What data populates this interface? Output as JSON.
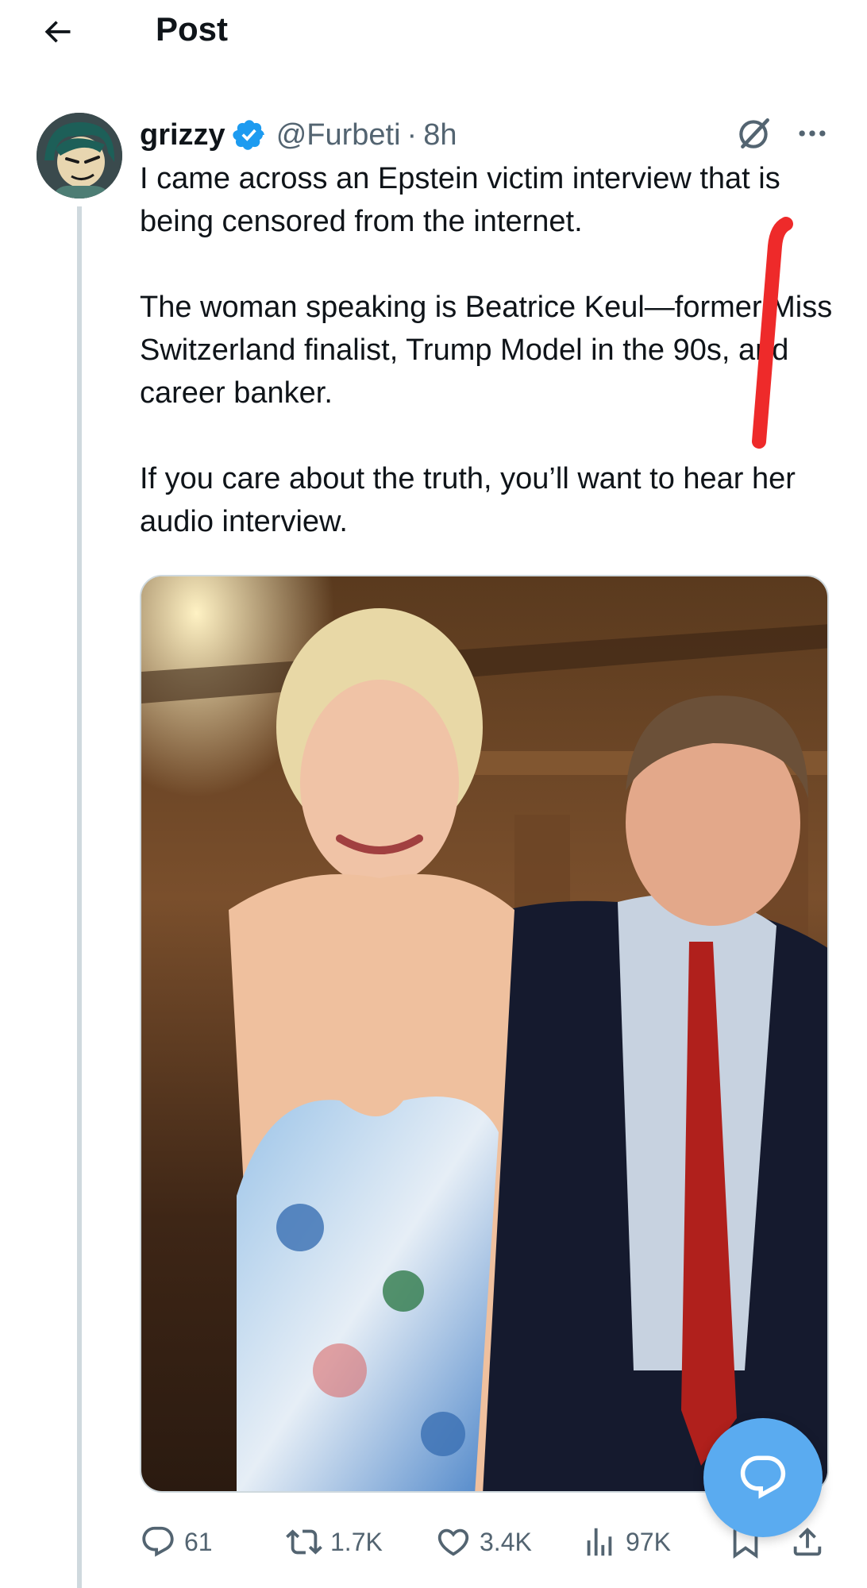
{
  "header": {
    "title": "Post",
    "back_icon": "arrow-left-icon"
  },
  "post": {
    "display_name": "grizzy",
    "verified": true,
    "handle": "@Furbeti",
    "separator": "·",
    "time": "8h",
    "paragraphs": [
      "I came across an Epstein victim interview that is being censored from the internet.",
      "The woman speaking is Beatrice Keul—former Miss Switzerland finalist, Trump Model in the 90s, and career banker.",
      "If you care about the truth, you’ll want to hear her audio interview."
    ]
  },
  "actions": {
    "replies": "61",
    "reposts": "1.7K",
    "likes": "3.4K",
    "views": "97K"
  },
  "icons": {
    "verified": "verified-badge-icon",
    "grok": "grok-icon",
    "more": "more-icon",
    "reply": "reply-icon",
    "repost": "repost-icon",
    "like": "heart-icon",
    "views": "views-icon",
    "bookmark": "bookmark-icon",
    "share": "share-icon",
    "fab": "reply-compose-icon"
  },
  "colors": {
    "text_primary": "#0f1419",
    "text_secondary": "#536471",
    "verified_blue": "#1d9bf0",
    "fab_blue": "#5aabf0",
    "annotation_red": "#ee2a2a",
    "divider": "#cfd9de"
  }
}
